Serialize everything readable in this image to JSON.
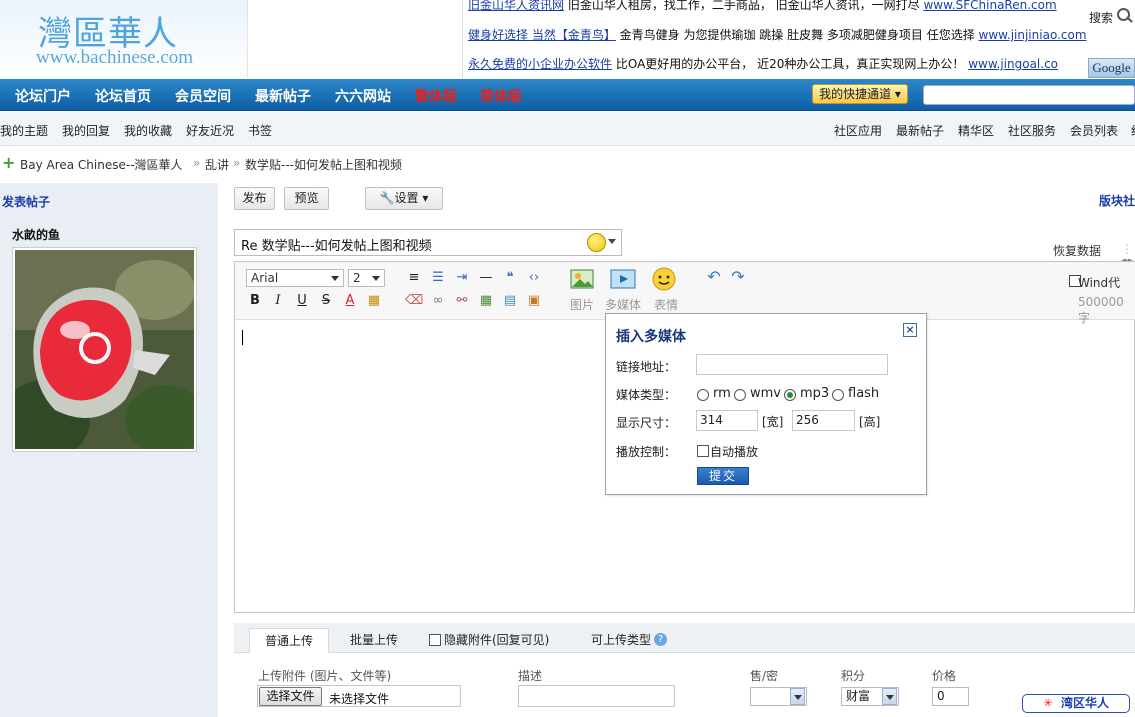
{
  "logo": {
    "cn": "灣區華人",
    "en": "www.bachinese.com"
  },
  "ads": [
    {
      "link": "旧金山华人资讯网",
      "text": " 旧金山华人租房，找工作，二手商品， 旧金山华人资讯，一网打尽 ",
      "url": "www.SFChinaRen.com"
    },
    {
      "link": "健身好选择 当然【金青鸟】",
      "text": " 金青鸟健身 为您提供瑜珈 跳操 肚皮舞 多项减肥健身项目 任您选择 ",
      "url": "www.jinjiniao.com"
    },
    {
      "link": "永久免费的小企业办公软件",
      "text": " 比OA更好用的办公平台， 近20种办公工具，真正实现网上办公！ ",
      "url": "www.jingoal.co"
    }
  ],
  "google": "Google",
  "nav": {
    "items": [
      "论坛门户",
      "论坛首页",
      "会员空间",
      "最新帖子",
      "六六网站"
    ],
    "red_items": [
      "繁体版",
      "简体版"
    ],
    "quick": "我的快捷通道",
    "search_label": "搜索"
  },
  "subnav": {
    "left": [
      "我的主题",
      "我的回复",
      "我的收藏",
      "好友近况",
      "书签"
    ],
    "right": [
      "社区应用",
      "最新帖子",
      "精华区",
      "社区服务",
      "会员列表",
      "统"
    ]
  },
  "breadcrumb": [
    "Bay Area Chinese--灣區華人",
    "乱讲",
    "数学贴---如何发帖上图和视频"
  ],
  "sidebar": {
    "title": "发表帖子",
    "username": "水畝的鱼"
  },
  "toolbar": {
    "publish": "发布",
    "preview": "预览",
    "settings": "设置",
    "banzhu": "版块社"
  },
  "subject": {
    "value": "Re 数学贴---如何发帖上图和视频"
  },
  "restore": "恢复数据",
  "restore_sep": "草",
  "editor": {
    "font": "Arial",
    "size": "2",
    "image_label": "图片",
    "media_label": "多媒体",
    "emoji_label": "表情",
    "wind_label": "Wind代",
    "limit": "500000字"
  },
  "popup": {
    "title": "插入多媒体",
    "url_label": "链接地址：",
    "type_label": "媒体类型：",
    "types": [
      "rm",
      "wmv",
      "mp3",
      "flash"
    ],
    "selected_type": "mp3",
    "size_label": "显示尺寸：",
    "width": "314",
    "width_unit": "[宽]",
    "height": "256",
    "height_unit": "[高]",
    "play_label": "播放控制：",
    "autoplay": "自动播放",
    "submit": "提交"
  },
  "upload": {
    "tabs": [
      "普通上传",
      "批量上传"
    ],
    "hide_label": "隐藏附件(回复可见)",
    "types_label": "可上传类型",
    "headers": {
      "file": "上传附件 (图片、文件等)",
      "desc": "描述",
      "sell": "售/密",
      "score": "积分",
      "price": "价格"
    },
    "choose": "选择文件",
    "no_file": "未选择文件",
    "score_value": "财富",
    "price_value": "0"
  },
  "badge": "湾区华人",
  "badge_star": "✳",
  "colors": {
    "nav": "#1771b8",
    "red_nav": "#e8231c",
    "link": "#1a3ea8",
    "submit": "#2a6cc3"
  }
}
